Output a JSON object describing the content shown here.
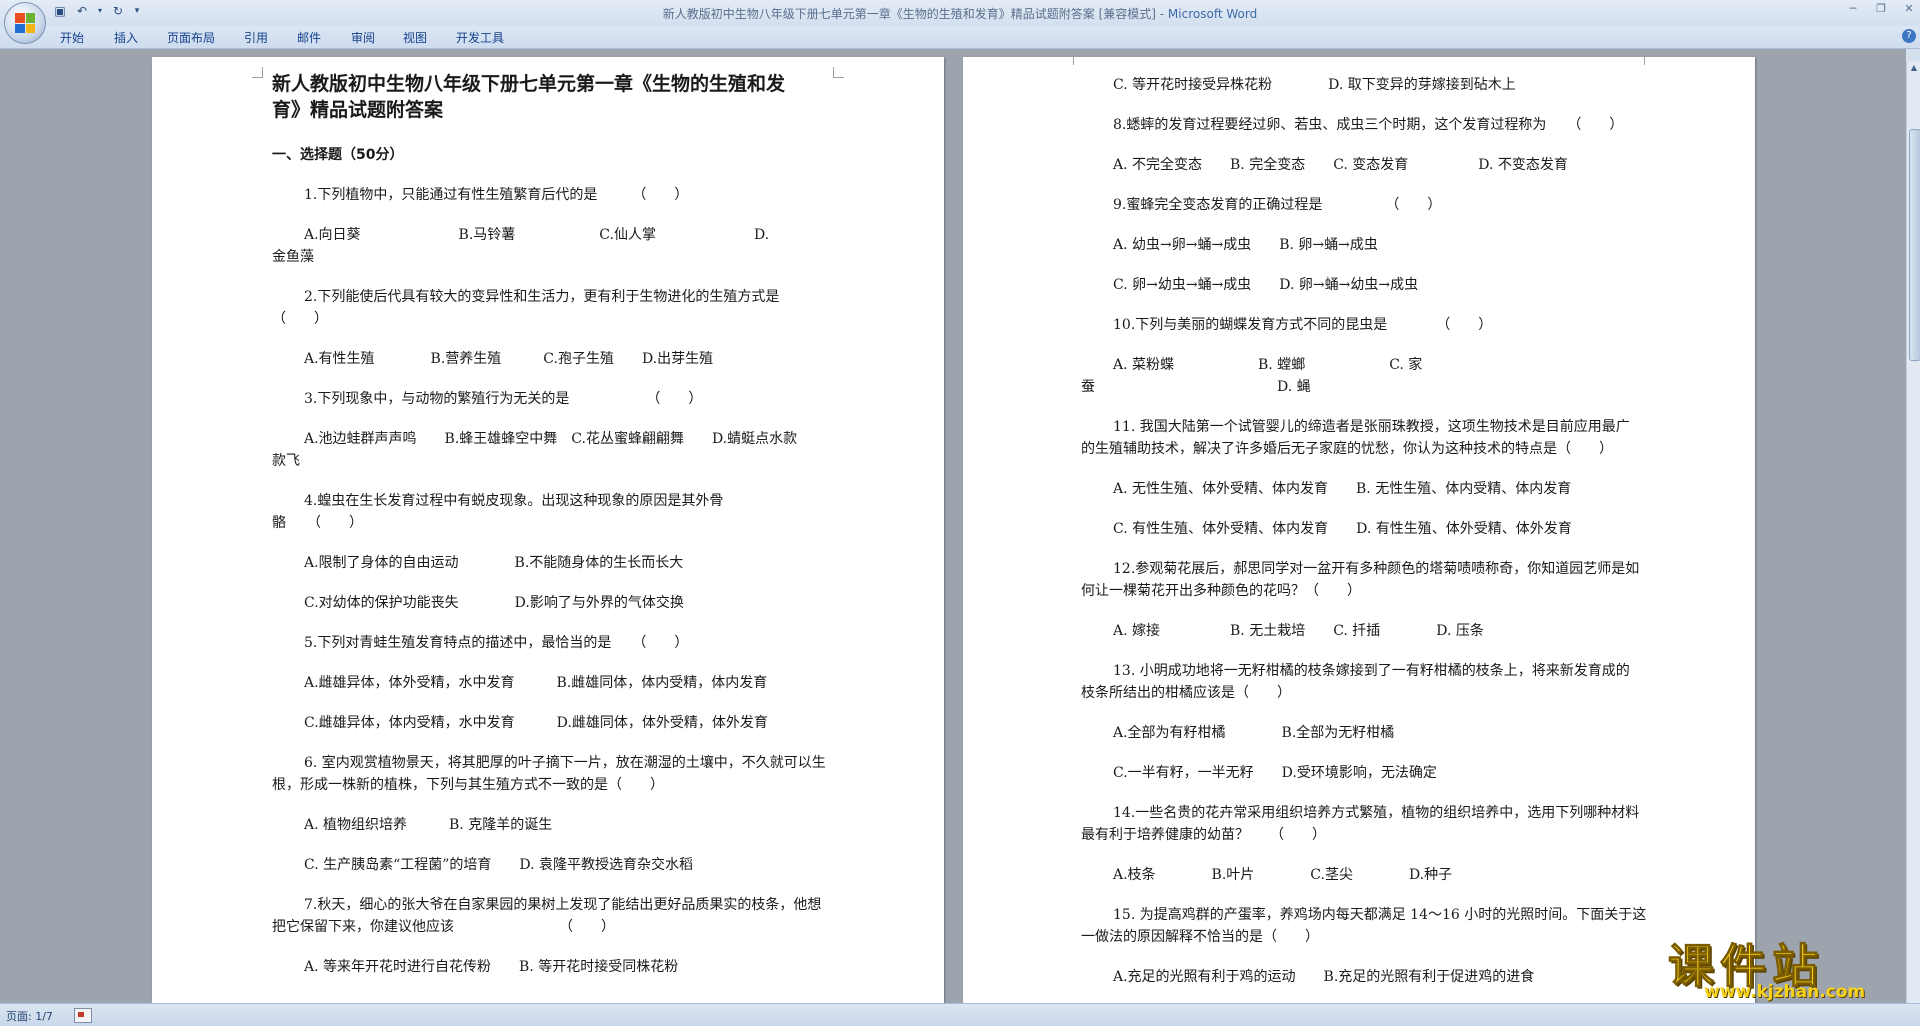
{
  "window": {
    "title": "新人教版初中生物八年级下册七单元第一章《生物的生殖和发育》精品试题附答案 [兼容模式] - ",
    "app_name": "Microsoft Word"
  },
  "ribbon": {
    "tabs": [
      "开始",
      "插入",
      "页面布局",
      "引用",
      "邮件",
      "审阅",
      "视图",
      "开发工具"
    ]
  },
  "status": {
    "page": "页面: 1/7"
  },
  "watermark": {
    "title": "课件站",
    "url": "www.kjzhan.com"
  },
  "colors": {
    "title_bar": "#dbe6f4",
    "tab_text": "#15428b",
    "workspace": "#9da4ad",
    "watermark": "#f7d21a"
  },
  "left_page": [
    "新人教版初中生物八年级下册七单元第一章《生物的生殖和发",
    "育》精品试题附答案",
    "一、选择题（50分）",
    "1.下列植物中，只能通过有性生殖繁育后代的是　　　（　　）",
    "A.向日葵　　　　　　　B.马铃薯　　　　　　C.仙人掌　　　　　　　D.",
    "金鱼藻",
    "2.下列能使后代具有较大的变异性和生活力，更有利于生物进化的生殖方式是",
    "（　　）",
    "A.有性生殖　　　　B.营养生殖　　　C.孢子生殖　　D.出芽生殖",
    "3.下列现象中，与动物的繁殖行为无关的是　　　　　　（　　）",
    "A.池边蛙群声声鸣　　B.蜂王雄蜂空中舞　C.花丛蜜蜂翩翩舞　　D.蜻蜓点水款",
    "款飞",
    "4.蝗虫在生长发育过程中有蜕皮现象。出现这种现象的原因是其外骨",
    "骼　　（　　）",
    "A.限制了身体的自由运动　　　　B.不能随身体的生长而长大",
    "C.对幼体的保护功能丧失　　　　D.影响了与外界的气体交换",
    "5.下列对青蛙生殖发育特点的描述中，最恰当的是　　（　　）",
    "A.雌雄异体，体外受精，水中发育　　　B.雌雄同体，体内受精，体内发育",
    "C.雌雄异体，体内受精，水中发育　　　D.雌雄同体，体外受精，体外发育",
    "6. 室内观赏植物景天，将其肥厚的叶子摘下一片，放在潮湿的土壤中，不久就可以生",
    "根，形成一株新的植株，下列与其生殖方式不一致的是（　　）",
    "A. 植物组织培养　　　B. 克隆羊的诞生",
    "C. 生产胰岛素“工程菌”的培育　　D. 袁隆平教授选育杂交水稻",
    "7.秋天，细心的张大爷在自家果园的果树上发现了能结出更好品质果实的枝条，他想",
    "把它保留下来，你建议他应该　　　　　　　　（　　）",
    "A. 等来年开花时进行自花传粉　　B. 等开花时接受同株花粉"
  ],
  "right_page": [
    "C. 等开花时接受异株花粉　　　　D. 取下变异的芽嫁接到砧木上",
    "8.蟋蟀的发育过程要经过卵、若虫、成虫三个时期，这个发育过程称为　　（　　）",
    "A. 不完全变态　　B. 完全变态　　C. 变态发育　　　　　D. 不变态发育",
    "9.蜜蜂完全变态发育的正确过程是　　　　　（　　）",
    "A. 幼虫→卵→蛹→成虫　　B. 卵→蛹→成虫",
    "C. 卵→幼虫→蛹→成虫　　D. 卵→蛹→幼虫→成虫",
    "10.下列与美丽的蝴蝶发育方式不同的昆虫是　　　　（　　）",
    "A. 菜粉蝶　　　　　　B. 螳螂　　　　　　C. 家",
    "蚕　　　　　　　　　　　　　D. 蝇",
    "11. 我国大陆第一个试管婴儿的缔造者是张丽珠教授，这项生物技术是目前应用最广",
    "的生殖辅助技术，解决了许多婚后无子家庭的忧愁，你认为这种技术的特点是（　　）",
    "A. 无性生殖、体外受精、体内发育　　B. 无性生殖、体内受精、体内发育",
    "C. 有性生殖、体外受精、体内发育　　D. 有性生殖、体外受精、体外发育",
    "12.参观菊花展后，郝思同学对一盆开有多种颜色的塔菊啧啧称奇，你知道园艺师是如",
    "何让一棵菊花开出多种颜色的花吗？（　　）",
    "A. 嫁接　　　　　B. 无土栽培　　C. 扦插　　　　D. 压条",
    "13. 小明成功地将一无籽柑橘的枝条嫁接到了一有籽柑橘的枝条上，将来新发育成的",
    "枝条所结出的柑橘应该是（　　）",
    "A.全部为有籽柑橘　　　　B.全部为无籽柑橘",
    "C.一半有籽，一半无籽　　D.受环境影响，无法确定",
    "14.一些名贵的花卉常采用组织培养方式繁殖，植物的组织培养中，选用下列哪种材料",
    "最有利于培养健康的幼苗？　　（　　）",
    "A.枝条　　　　B.叶片　　　　C.茎尖　　　　D.种子",
    "15. 为提高鸡群的产蛋率，养鸡场内每天都满足 14～16 小时的光照时间。下面关于这",
    "一做法的原因解释不恰当的是（　　）",
    "A.充足的光照有利于鸡的运动　　B.充足的光照有利于促进鸡的进食"
  ]
}
